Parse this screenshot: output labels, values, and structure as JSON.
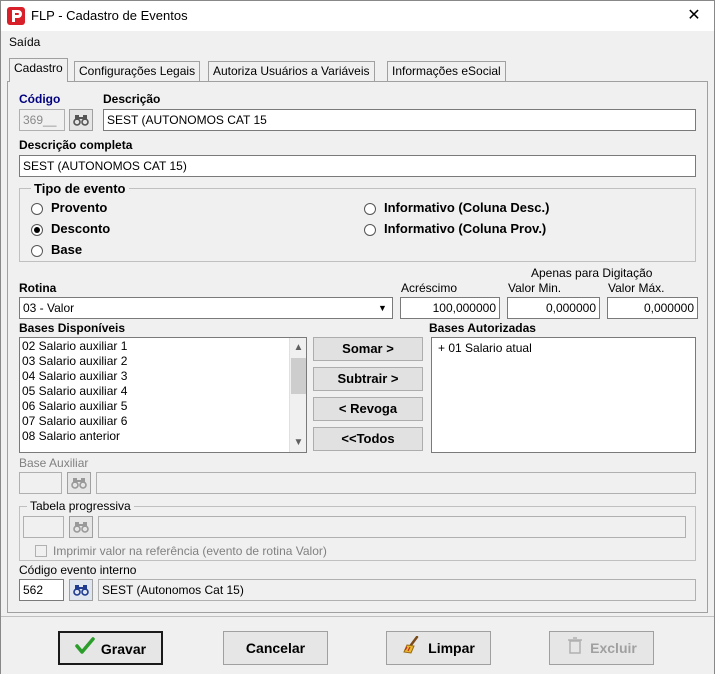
{
  "window": {
    "title": "FLP - Cadastro de Eventos",
    "close_glyph": "✕"
  },
  "menu": {
    "items": [
      "Saída"
    ]
  },
  "tabs": [
    {
      "label": "Cadastro",
      "active": true
    },
    {
      "label": "Configurações Legais",
      "active": false
    },
    {
      "label": "Autoriza Usuários a Variáveis",
      "active": false
    },
    {
      "label": "Informações eSocial",
      "active": false
    }
  ],
  "form": {
    "codigo_label": "Código",
    "codigo_value": "369__",
    "descricao_label": "Descrição",
    "descricao_value": "SEST (AUTONOMOS CAT 15",
    "descricao_completa_label": "Descrição completa",
    "descricao_completa_value": "SEST (AUTONOMOS CAT 15)",
    "tipo_evento": {
      "title": "Tipo de evento",
      "options": [
        {
          "label": "Provento",
          "checked": false
        },
        {
          "label": "Desconto",
          "checked": true
        },
        {
          "label": "Base",
          "checked": false
        },
        {
          "label": "Informativo (Coluna Desc.)",
          "checked": false
        },
        {
          "label": "Informativo (Coluna Prov.)",
          "checked": false
        }
      ]
    },
    "rotina_label": "Rotina",
    "rotina_value": "03 - Valor",
    "acrescimo_label": "Acréscimo",
    "acrescimo_value": "100,000000",
    "apenas_digitacao_label": "Apenas para Digitação",
    "valor_min_label": "Valor Min.",
    "valor_min_value": "0,000000",
    "valor_max_label": "Valor Máx.",
    "valor_max_value": "0,000000",
    "bases_disponiveis_label": "Bases Disponíveis",
    "bases_disponiveis": [
      "02 Salario auxiliar 1",
      "03 Salario auxiliar 2",
      "04 Salario auxiliar 3",
      "05 Salario auxiliar 4",
      "06 Salario auxiliar 5",
      "07 Salario auxiliar 6",
      "08 Salario anterior"
    ],
    "bases_autorizadas_label": "Bases Autorizadas",
    "bases_autorizadas": [
      "+ 01 Salario atual"
    ],
    "buttons": {
      "somar": "Somar >",
      "subtrair": "Subtrair >",
      "revoga": "< Revoga",
      "todos": "<<Todos"
    },
    "base_auxiliar_label": "Base Auxiliar",
    "base_auxiliar_code": "",
    "base_auxiliar_desc": "",
    "tabela_progressiva_label": "Tabela progressiva",
    "tabela_progressiva_code": "",
    "tabela_progressiva_desc": "",
    "imprimir_label": "Imprimir valor na referência (evento de rotina Valor)",
    "codigo_evento_interno_label": "Código evento interno",
    "codigo_evento_interno_value": "562",
    "codigo_evento_interno_desc": "SEST (Autonomos Cat 15)"
  },
  "actions": {
    "gravar": "Gravar",
    "cancelar": "Cancelar",
    "limpar": "Limpar",
    "excluir": "Excluir"
  },
  "colors": {
    "navy_label": "#000080",
    "app_icon_red": "#d8202a",
    "gravar_check_green": "#2a9d2a"
  }
}
